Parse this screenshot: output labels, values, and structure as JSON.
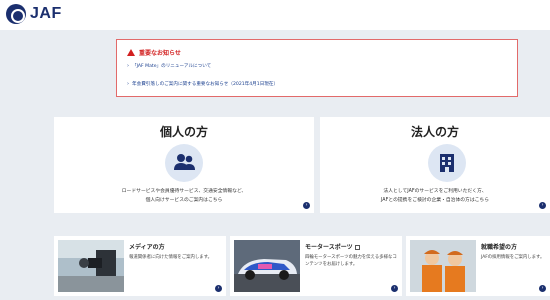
{
  "header": {
    "logo_text": "JAF"
  },
  "notice": {
    "title": "重要なお知らせ",
    "links": [
      "「JAF Mate」のリニューアルについて",
      "年会費引落しのご案内に関する重要なお知らせ（2021年4月1日現在）"
    ]
  },
  "big_cards": {
    "personal": {
      "title": "個人の方",
      "desc_line1": "ロードサービスや会員優待サービス、交通安全情報など、",
      "desc_line2": "個人向けサービスのご案内はこちら"
    },
    "corporate": {
      "title": "法人の方",
      "desc_line1": "法人としてJAFのサービスをご利用いただく方、",
      "desc_line2": "JAFとの提携をご検討の企業・自治体の方はこちら"
    }
  },
  "small_cards": {
    "media": {
      "title": "メディアの方",
      "desc": "報道関係者に向けた情報をご案内します。"
    },
    "motorsports": {
      "title": "モータースポーツ",
      "desc": "四輪モータースポーツの魅力を伝える多様なコンテンツをお届けします。"
    },
    "recruit": {
      "title": "就職希望の方",
      "desc": "JAFの採用情報をご案内します。"
    }
  },
  "colors": {
    "brand_navy": "#1b2f6e",
    "alert_red": "#d21f1f",
    "link_blue": "#1a3f8f",
    "page_bg": "#e9edf2"
  },
  "icons": {
    "logo": "jaf-emblem-icon",
    "warning": "warning-triangle-icon",
    "personal": "people-icon",
    "corporate": "building-icon",
    "arrow": "chevron-right-circle-icon",
    "external": "external-link-icon"
  }
}
